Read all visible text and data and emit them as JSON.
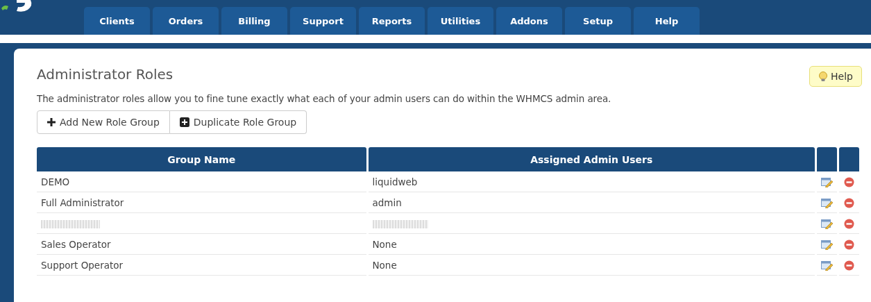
{
  "nav": {
    "tabs": [
      {
        "label": "Clients",
        "selected": false
      },
      {
        "label": "Orders",
        "selected": false
      },
      {
        "label": "Billing",
        "selected": false
      },
      {
        "label": "Support",
        "selected": false
      },
      {
        "label": "Reports",
        "selected": false
      },
      {
        "label": "Utilities",
        "selected": false
      },
      {
        "label": "Addons",
        "selected": false
      },
      {
        "label": "Setup",
        "selected": false
      },
      {
        "label": "Help",
        "selected": false
      }
    ]
  },
  "page": {
    "title": "Administrator Roles",
    "help_button": "Help",
    "description": "The administrator roles allow you to fine tune exactly what each of your admin users can do within the WHMCS admin area.",
    "actions": [
      {
        "label": "Add New Role Group",
        "kind": "plus"
      },
      {
        "label": "Duplicate Role Group",
        "kind": "plus-square"
      }
    ]
  },
  "table": {
    "columns": [
      "Group Name",
      "Assigned Admin Users"
    ],
    "rows": [
      {
        "kind": "text",
        "group_name": "DEMO",
        "assigned": "liquidweb"
      },
      {
        "kind": "text",
        "group_name": "Full Administrator",
        "assigned": "admin"
      },
      {
        "kind": "redacted"
      },
      {
        "kind": "text",
        "group_name": "Sales Operator",
        "assigned": "None"
      },
      {
        "kind": "text",
        "group_name": "Support Operator",
        "assigned": "None"
      }
    ]
  }
}
